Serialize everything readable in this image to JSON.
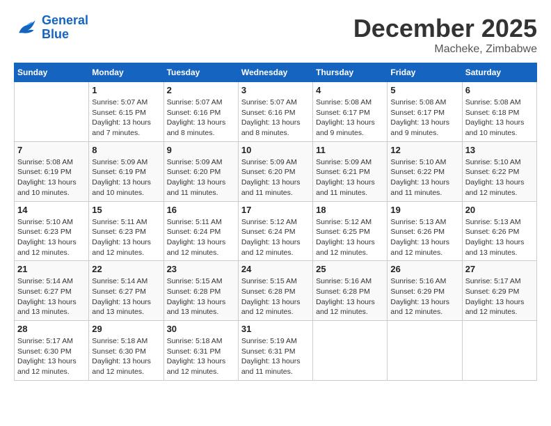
{
  "header": {
    "logo_line1": "General",
    "logo_line2": "Blue",
    "month": "December 2025",
    "location": "Macheke, Zimbabwe"
  },
  "weekdays": [
    "Sunday",
    "Monday",
    "Tuesday",
    "Wednesday",
    "Thursday",
    "Friday",
    "Saturday"
  ],
  "weeks": [
    [
      {
        "day": "",
        "info": ""
      },
      {
        "day": "1",
        "info": "Sunrise: 5:07 AM\nSunset: 6:15 PM\nDaylight: 13 hours\nand 7 minutes."
      },
      {
        "day": "2",
        "info": "Sunrise: 5:07 AM\nSunset: 6:16 PM\nDaylight: 13 hours\nand 8 minutes."
      },
      {
        "day": "3",
        "info": "Sunrise: 5:07 AM\nSunset: 6:16 PM\nDaylight: 13 hours\nand 8 minutes."
      },
      {
        "day": "4",
        "info": "Sunrise: 5:08 AM\nSunset: 6:17 PM\nDaylight: 13 hours\nand 9 minutes."
      },
      {
        "day": "5",
        "info": "Sunrise: 5:08 AM\nSunset: 6:17 PM\nDaylight: 13 hours\nand 9 minutes."
      },
      {
        "day": "6",
        "info": "Sunrise: 5:08 AM\nSunset: 6:18 PM\nDaylight: 13 hours\nand 10 minutes."
      }
    ],
    [
      {
        "day": "7",
        "info": "Sunrise: 5:08 AM\nSunset: 6:19 PM\nDaylight: 13 hours\nand 10 minutes."
      },
      {
        "day": "8",
        "info": "Sunrise: 5:09 AM\nSunset: 6:19 PM\nDaylight: 13 hours\nand 10 minutes."
      },
      {
        "day": "9",
        "info": "Sunrise: 5:09 AM\nSunset: 6:20 PM\nDaylight: 13 hours\nand 11 minutes."
      },
      {
        "day": "10",
        "info": "Sunrise: 5:09 AM\nSunset: 6:20 PM\nDaylight: 13 hours\nand 11 minutes."
      },
      {
        "day": "11",
        "info": "Sunrise: 5:09 AM\nSunset: 6:21 PM\nDaylight: 13 hours\nand 11 minutes."
      },
      {
        "day": "12",
        "info": "Sunrise: 5:10 AM\nSunset: 6:22 PM\nDaylight: 13 hours\nand 11 minutes."
      },
      {
        "day": "13",
        "info": "Sunrise: 5:10 AM\nSunset: 6:22 PM\nDaylight: 13 hours\nand 12 minutes."
      }
    ],
    [
      {
        "day": "14",
        "info": "Sunrise: 5:10 AM\nSunset: 6:23 PM\nDaylight: 13 hours\nand 12 minutes."
      },
      {
        "day": "15",
        "info": "Sunrise: 5:11 AM\nSunset: 6:23 PM\nDaylight: 13 hours\nand 12 minutes."
      },
      {
        "day": "16",
        "info": "Sunrise: 5:11 AM\nSunset: 6:24 PM\nDaylight: 13 hours\nand 12 minutes."
      },
      {
        "day": "17",
        "info": "Sunrise: 5:12 AM\nSunset: 6:24 PM\nDaylight: 13 hours\nand 12 minutes."
      },
      {
        "day": "18",
        "info": "Sunrise: 5:12 AM\nSunset: 6:25 PM\nDaylight: 13 hours\nand 12 minutes."
      },
      {
        "day": "19",
        "info": "Sunrise: 5:13 AM\nSunset: 6:26 PM\nDaylight: 13 hours\nand 12 minutes."
      },
      {
        "day": "20",
        "info": "Sunrise: 5:13 AM\nSunset: 6:26 PM\nDaylight: 13 hours\nand 13 minutes."
      }
    ],
    [
      {
        "day": "21",
        "info": "Sunrise: 5:14 AM\nSunset: 6:27 PM\nDaylight: 13 hours\nand 13 minutes."
      },
      {
        "day": "22",
        "info": "Sunrise: 5:14 AM\nSunset: 6:27 PM\nDaylight: 13 hours\nand 13 minutes."
      },
      {
        "day": "23",
        "info": "Sunrise: 5:15 AM\nSunset: 6:28 PM\nDaylight: 13 hours\nand 13 minutes."
      },
      {
        "day": "24",
        "info": "Sunrise: 5:15 AM\nSunset: 6:28 PM\nDaylight: 13 hours\nand 12 minutes."
      },
      {
        "day": "25",
        "info": "Sunrise: 5:16 AM\nSunset: 6:28 PM\nDaylight: 13 hours\nand 12 minutes."
      },
      {
        "day": "26",
        "info": "Sunrise: 5:16 AM\nSunset: 6:29 PM\nDaylight: 13 hours\nand 12 minutes."
      },
      {
        "day": "27",
        "info": "Sunrise: 5:17 AM\nSunset: 6:29 PM\nDaylight: 13 hours\nand 12 minutes."
      }
    ],
    [
      {
        "day": "28",
        "info": "Sunrise: 5:17 AM\nSunset: 6:30 PM\nDaylight: 13 hours\nand 12 minutes."
      },
      {
        "day": "29",
        "info": "Sunrise: 5:18 AM\nSunset: 6:30 PM\nDaylight: 13 hours\nand 12 minutes."
      },
      {
        "day": "30",
        "info": "Sunrise: 5:18 AM\nSunset: 6:31 PM\nDaylight: 13 hours\nand 12 minutes."
      },
      {
        "day": "31",
        "info": "Sunrise: 5:19 AM\nSunset: 6:31 PM\nDaylight: 13 hours\nand 11 minutes."
      },
      {
        "day": "",
        "info": ""
      },
      {
        "day": "",
        "info": ""
      },
      {
        "day": "",
        "info": ""
      }
    ]
  ]
}
